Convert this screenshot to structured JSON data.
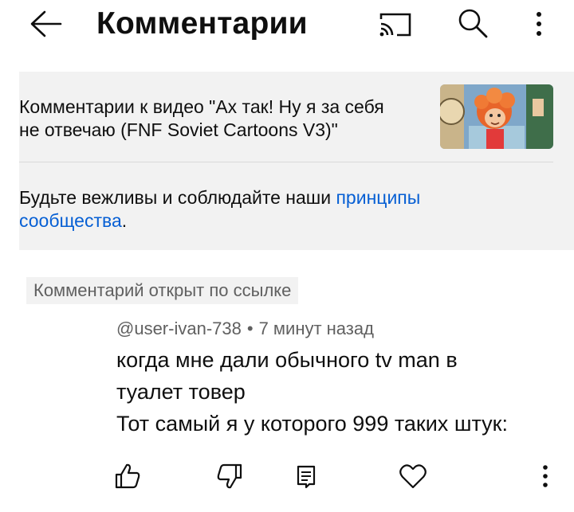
{
  "header": {
    "title": "Комментарии",
    "icons": [
      "arrow-left-icon",
      "cast-icon",
      "search-icon",
      "more-vert-icon"
    ]
  },
  "video": {
    "line1": "Комментарии к видео \"Ах так! Ну я за себя",
    "line2": "не отвечаю (FNF Soviet Cartoons V3)\""
  },
  "rules": {
    "text": "Будьте вежливы и соблюдайте наши ",
    "link1": "принципы",
    "link2": "сообщества",
    "end": "."
  },
  "comment": {
    "badge": "Комментарий открыт по ссылке",
    "author": "@user-ivan-738",
    "separator": "•",
    "time": "7 минут назад",
    "lines": [
      "когда мне дали обычного tv man в",
      "туалет товер",
      "Тот самый я у которого 999 таких штук:"
    ],
    "actions": [
      "thumb-up-icon",
      "thumb-down-icon",
      "reply-icon",
      "heart-icon",
      "more-vert-icon"
    ]
  },
  "colors": {
    "link": "#065fd4",
    "panel": "#f2f2f2",
    "secondary_text": "#606060"
  }
}
